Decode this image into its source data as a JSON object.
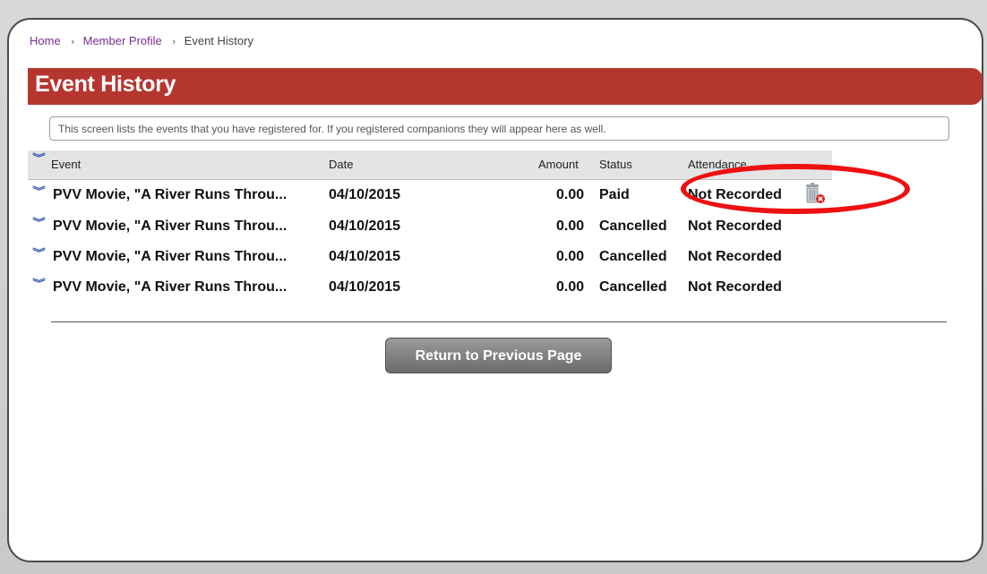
{
  "breadcrumb": {
    "home": "Home",
    "member_profile": "Member Profile",
    "current": "Event History"
  },
  "page_title": "Event History",
  "info_text": "This screen lists the events that you have registered for. If you registered companions they will appear here as well.",
  "table": {
    "headers": {
      "event": "Event",
      "date": "Date",
      "amount": "Amount",
      "status": "Status",
      "attendance": "Attendance"
    },
    "rows": [
      {
        "event": "PVV Movie, \"A River Runs Throu...",
        "date": "04/10/2015",
        "amount": "0.00",
        "status": "Paid",
        "attendance": "Not Recorded"
      },
      {
        "event": "PVV Movie, \"A River Runs Throu...",
        "date": "04/10/2015",
        "amount": "0.00",
        "status": "Cancelled",
        "attendance": "Not Recorded"
      },
      {
        "event": "PVV Movie, \"A River Runs Throu...",
        "date": "04/10/2015",
        "amount": "0.00",
        "status": "Cancelled",
        "attendance": "Not Recorded"
      },
      {
        "event": "PVV Movie, \"A River Runs Throu...",
        "date": "04/10/2015",
        "amount": "0.00",
        "status": "Cancelled",
        "attendance": "Not Recorded"
      }
    ]
  },
  "return_button": "Return to Previous Page",
  "icons": {
    "expand": "chevron-double-down-icon",
    "delete": "trash-delete-icon"
  },
  "colors": {
    "title_bar": "#b5362f",
    "link": "#7a2e8e",
    "chevron": "#2a4fa8",
    "annotation": "#ee1111"
  }
}
